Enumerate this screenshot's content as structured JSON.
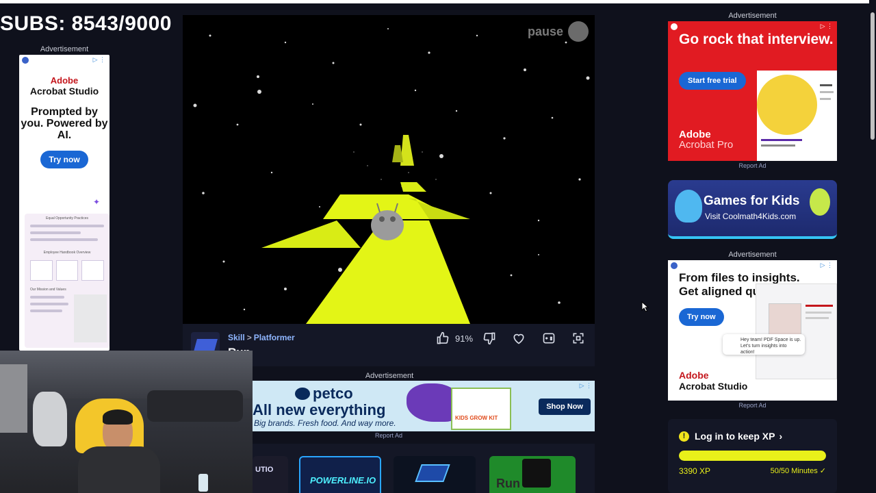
{
  "stream_overlay": {
    "subs_label": "SUBS: 8543/9000"
  },
  "ads": {
    "label": "Advertisement",
    "report": "Report Ad",
    "left": {
      "brand_line1": "Adobe",
      "brand_line2": "Acrobat Studio",
      "headline": "Prompted by you. Powered by AI.",
      "cta": "Try now",
      "doc_title": "Equal Opportunity Practices",
      "doc_section": "Employee Handbook Overview",
      "doc_section2": "Our Mission and Values"
    },
    "right_top": {
      "headline": "Go rock that interview.",
      "cta": "Start free trial",
      "brand_line1": "Adobe",
      "brand_line2": "Acrobat Pro"
    },
    "kids": {
      "title": "Games for Kids",
      "subtitle": "Visit Coolmath4Kids.com"
    },
    "right_bottom": {
      "headline": "From files to insights. Get aligned quicker.",
      "cta": "Try now",
      "bubble": "Hey team! PDF Space is up. Let's turn insights into action!",
      "brand_line1": "Adobe",
      "brand_line2": "Acrobat Studio"
    },
    "petco": {
      "logo": "petco",
      "headline": "All new everything",
      "sub": "Big brands. Fresh food. And way more.",
      "cta": "Shop Now",
      "box_label": "KIDS GROW KIT"
    }
  },
  "game": {
    "pause_label": "pause",
    "category": "Skill",
    "subcategory": "Platformer",
    "title_partial": "Run",
    "like_percent": "91%"
  },
  "thumbnails": [
    {
      "label": "UTIO",
      "color": "#1b1b2a"
    },
    {
      "label": "POWERLINE.IO",
      "color": "#10204a"
    },
    {
      "label": "",
      "color": "#0c1220"
    },
    {
      "label": "Run",
      "color": "#1f8a2a"
    }
  ],
  "xp_card": {
    "prompt": "Log in to keep XP",
    "xp_value": "3390 XP",
    "minutes": "50/50 Minutes",
    "progress": 1.0
  },
  "colors": {
    "page_bg": "#0f111c",
    "panel": "#141726",
    "accent_yellow": "#e9f01a",
    "link_blue": "#8fb6ff",
    "adobe_red": "#e11b22"
  }
}
